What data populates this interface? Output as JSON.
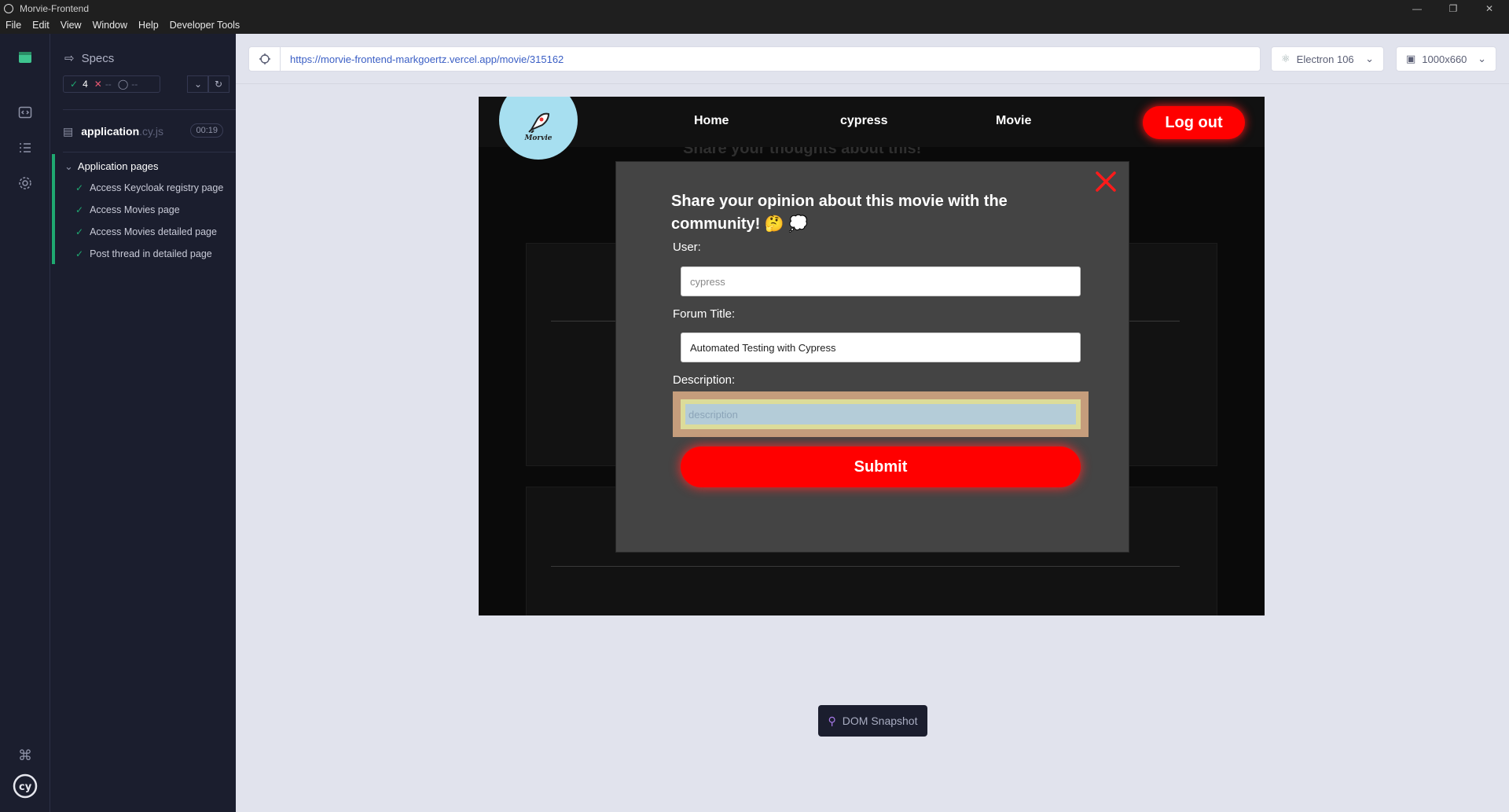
{
  "window": {
    "title": "Morvie-Frontend",
    "menu": [
      "File",
      "Edit",
      "View",
      "Window",
      "Help",
      "Developer Tools"
    ]
  },
  "specs": {
    "header": "Specs",
    "passed": "4",
    "failed": "--",
    "pending": "--",
    "file_name": "application",
    "file_ext": ".cy.js",
    "duration": "00:19",
    "suite_title": "Application pages",
    "tests": [
      "Access Keycloak registry page",
      "Access Movies page",
      "Access Movies detailed page",
      "Post thread in detailed page"
    ]
  },
  "browser": {
    "url": "https://morvie-frontend-markgoertz.vercel.app/movie/315162",
    "browser_name": "Electron 106",
    "viewport_size": "1000x660"
  },
  "app": {
    "logo_text": "Morvie",
    "nav": [
      "Home",
      "cypress",
      "Movie"
    ],
    "logout_label": "Log out",
    "background_heading": "Share your thoughts about this!",
    "modal": {
      "title": "Share your opinion about this movie with the community! 🤔 💭",
      "user_label": "User:",
      "user_value": "cypress",
      "forum_title_label": "Forum Title:",
      "forum_title_value": "Automated Testing with Cypress",
      "description_label": "Description:",
      "description_placeholder": "description",
      "submit_label": "Submit"
    }
  },
  "dom_snapshot_label": "DOM Snapshot",
  "colors": {
    "accent_red": "#ff0000",
    "pass_green": "#1fa971",
    "logo_blue": "#a7dff0"
  }
}
